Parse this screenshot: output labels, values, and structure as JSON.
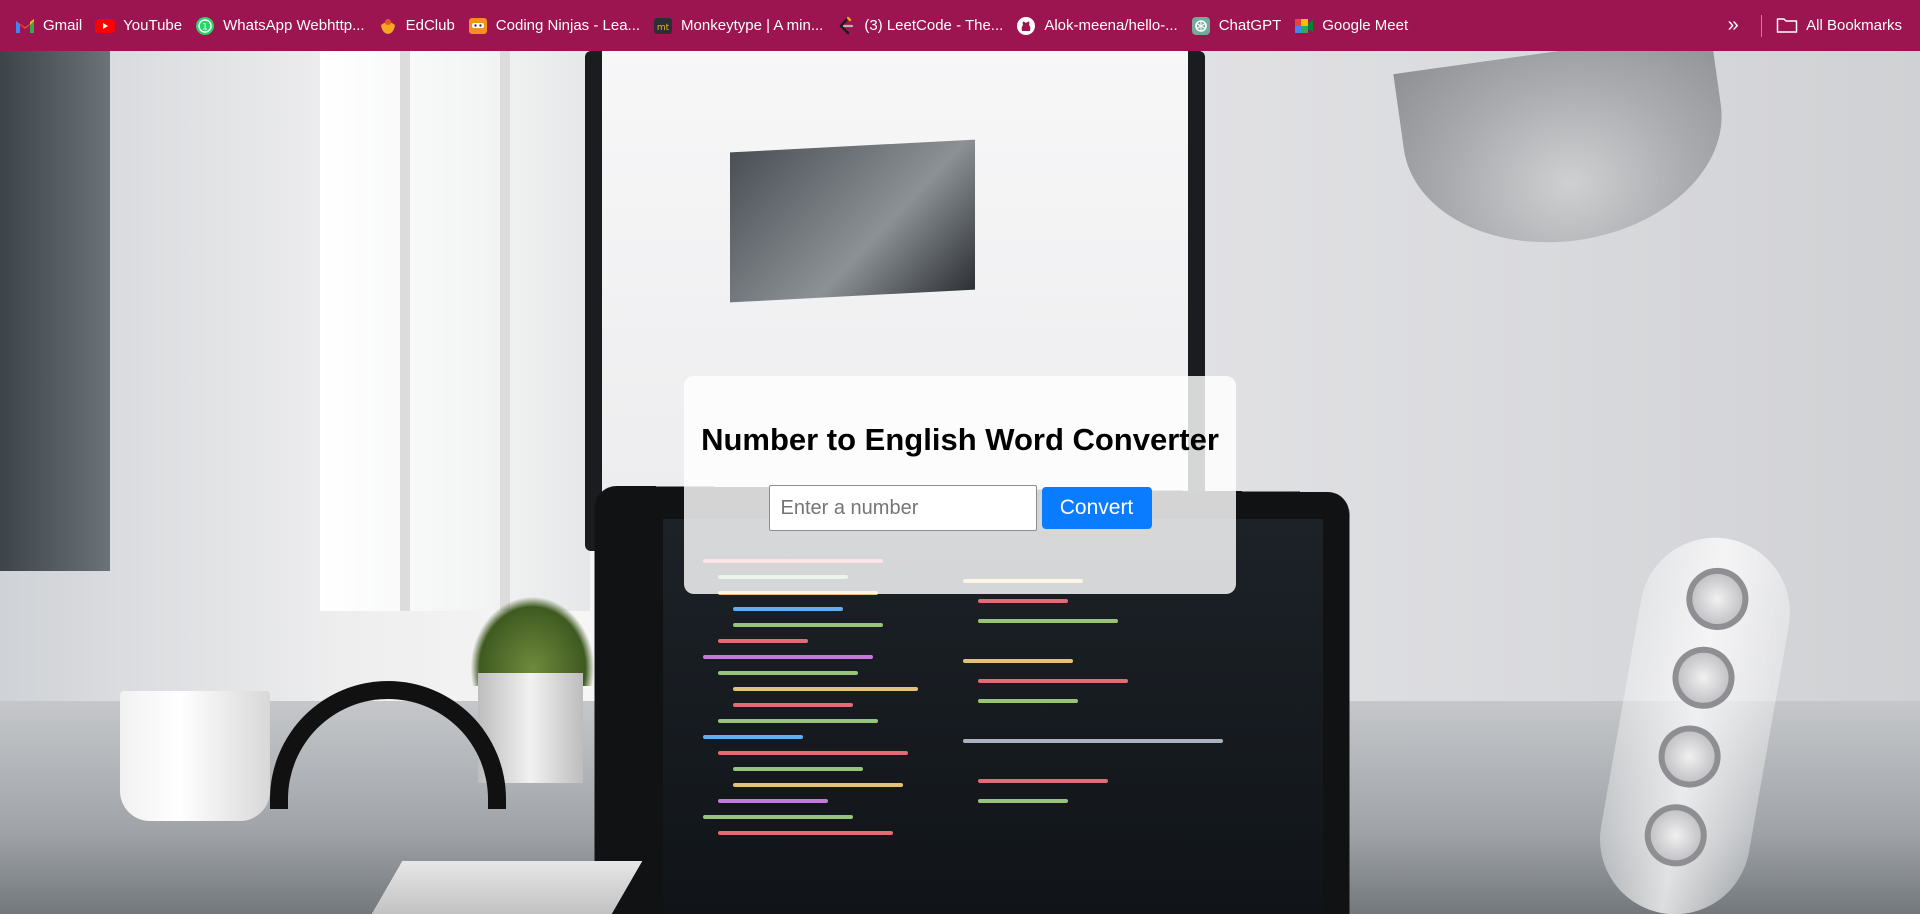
{
  "bookmarks_bar": {
    "items": [
      {
        "label": "Gmail",
        "icon": "gmail-icon"
      },
      {
        "label": "YouTube",
        "icon": "youtube-icon"
      },
      {
        "label": "WhatsApp Webhttp...",
        "icon": "whatsapp-icon"
      },
      {
        "label": "EdClub",
        "icon": "edclub-icon"
      },
      {
        "label": "Coding Ninjas - Lea...",
        "icon": "coding-ninjas-icon"
      },
      {
        "label": "Monkeytype | A min...",
        "icon": "monkeytype-icon"
      },
      {
        "label": "(3) LeetCode - The...",
        "icon": "leetcode-icon"
      },
      {
        "label": "Alok-meena/hello-...",
        "icon": "github-icon"
      },
      {
        "label": "ChatGPT",
        "icon": "chatgpt-icon"
      },
      {
        "label": "Google Meet",
        "icon": "google-meet-icon"
      }
    ],
    "overflow_icon": "double-chevron-right-icon",
    "all_bookmarks_label": "All Bookmarks",
    "all_bookmarks_icon": "folder-icon",
    "background_color": "#9c1450"
  },
  "converter": {
    "title": "Number to English Word Converter",
    "input_value": "",
    "input_placeholder": "Enter a number",
    "button_label": "Convert",
    "button_color": "#0a7cff"
  }
}
